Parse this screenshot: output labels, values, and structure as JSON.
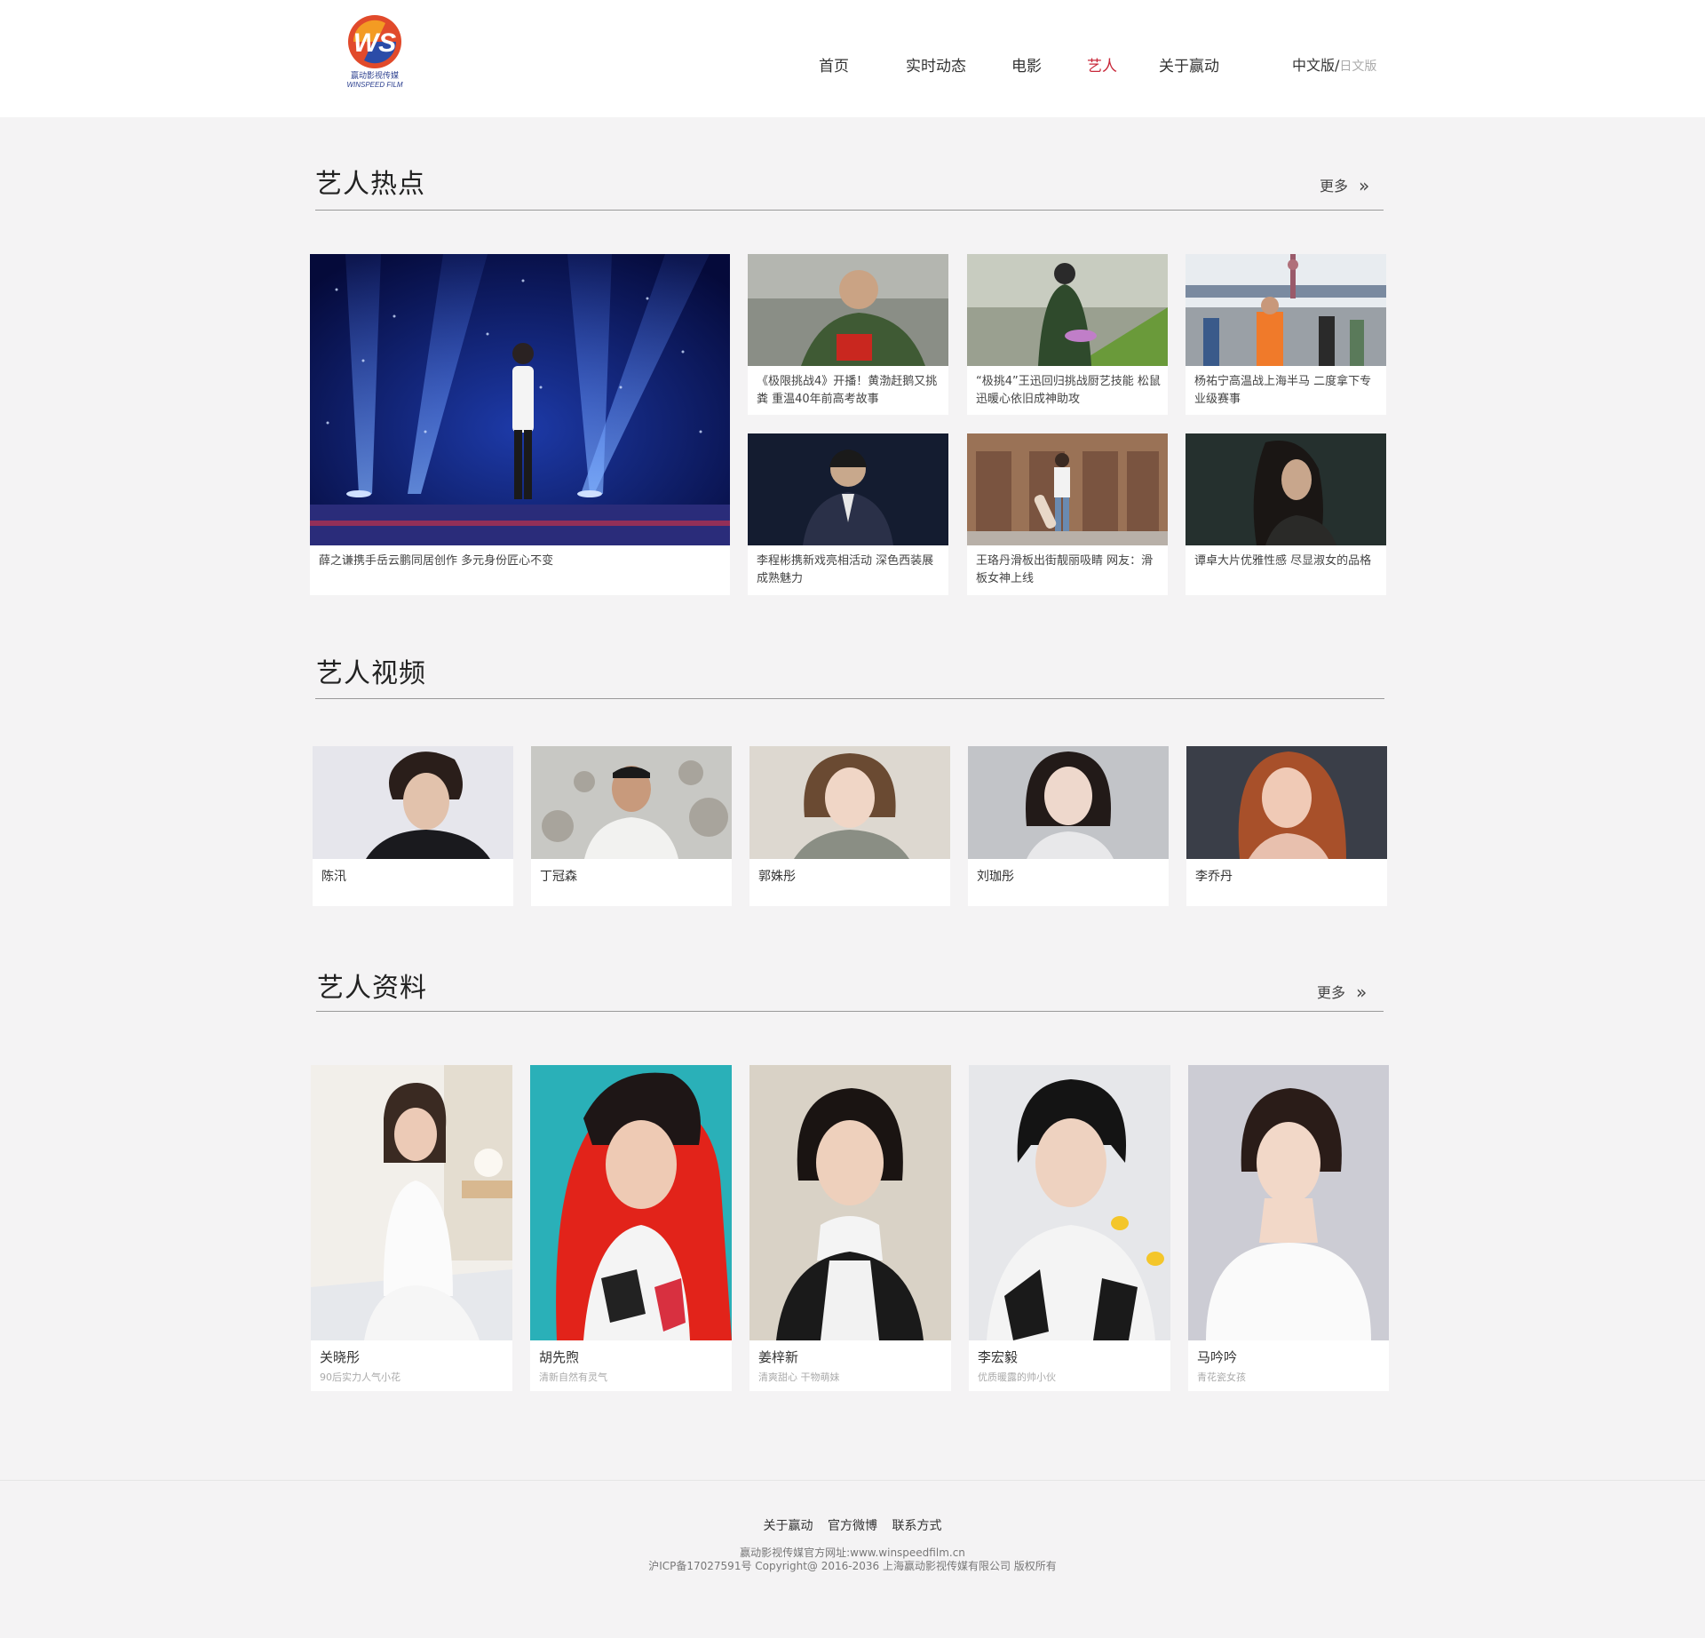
{
  "logo": {
    "text_cn": "赢动影视传媒",
    "text_en": "WINSPEED FILM"
  },
  "nav": {
    "items": [
      "首页",
      "实时动态",
      "电影",
      "艺人",
      "关于赢动"
    ],
    "lang_current": "中文版",
    "lang_sep": "/",
    "lang_alt": "日文版"
  },
  "hot": {
    "title": "艺人热点",
    "more": "更多",
    "main_caption": "薛之谦携手岳云鹏同居创作 多元身份匠心不变",
    "items": [
      "《极限挑战4》开播！黄渤赶鹅又挑粪 重温40年前高考故事",
      "“极挑4”王迅回归挑战厨艺技能 松鼠迅暖心依旧成神助攻",
      "杨祐宁高温战上海半马 二度拿下专业级赛事",
      "李程彬携新戏亮相活动 深色西装展成熟魅力",
      "王珞丹滑板出街靓丽吸睛 网友：滑板女神上线",
      "谭卓大片优雅性感 尽显淑女的品格"
    ]
  },
  "videos": {
    "title": "艺人视频",
    "items": [
      "陈汛",
      "丁冠森",
      "郭姝彤",
      "刘珈彤",
      "李乔丹"
    ]
  },
  "profiles": {
    "title": "艺人资料",
    "more": "更多",
    "items": [
      {
        "name": "关晓彤",
        "desc": "90后实力人气小花"
      },
      {
        "name": "胡先煦",
        "desc": "清新自然有灵气"
      },
      {
        "name": "姜梓新",
        "desc": "清爽甜心 干物萌妹"
      },
      {
        "name": "李宏毅",
        "desc": "优质暖露的帅小伙"
      },
      {
        "name": "马吟吟",
        "desc": "青花瓷女孩"
      }
    ]
  },
  "footer": {
    "links": [
      "关于赢动",
      "官方微博",
      "联系方式"
    ],
    "line1": "赢动影视传媒官方网址:www.winspeedfilm.cn",
    "line2": "沪ICP备17027591号  Copyright@ 2016-2036 上海赢动影视传媒有限公司 版权所有"
  },
  "colors": {
    "accent": "#c8283a",
    "background": "#f4f3f4"
  }
}
